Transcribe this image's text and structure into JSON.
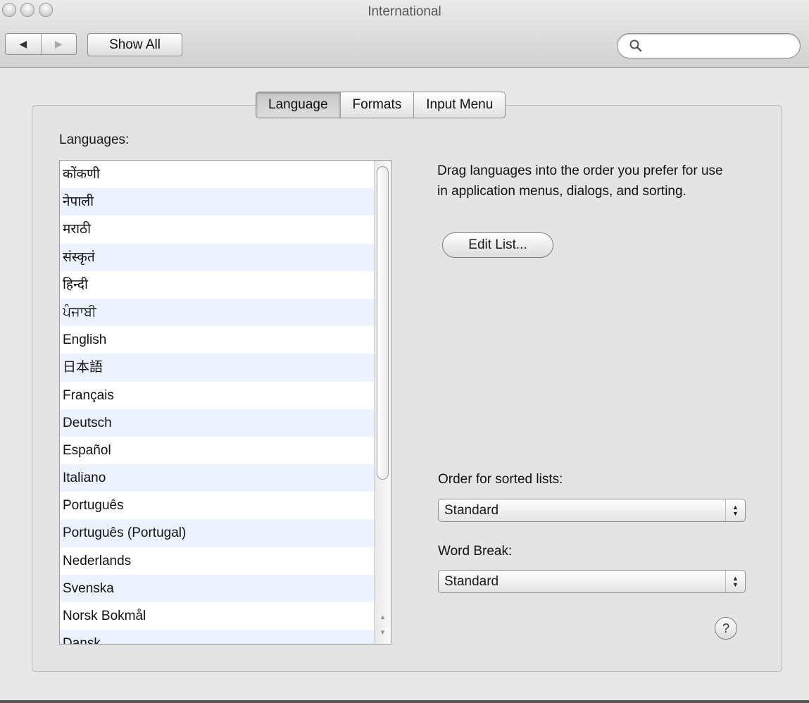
{
  "window": {
    "title": "International"
  },
  "toolbar": {
    "back_glyph": "◀",
    "forward_glyph": "▶",
    "show_all_label": "Show All",
    "search": {
      "value": "",
      "placeholder": ""
    }
  },
  "tabs": [
    {
      "label": "Language",
      "selected": true
    },
    {
      "label": "Formats",
      "selected": false
    },
    {
      "label": "Input Menu",
      "selected": false
    }
  ],
  "language_pane": {
    "languages_label": "Languages:",
    "languages": [
      "कोंकणी",
      "नेपाली",
      "मराठी",
      "संस्कृतं",
      "हिन्दी",
      "ਪੰਜਾਬੀ",
      "English",
      "日本語",
      "Français",
      "Deutsch",
      "Español",
      "Italiano",
      "Português",
      "Português (Portugal)",
      "Nederlands",
      "Svenska",
      "Norsk Bokmål",
      "Dansk"
    ],
    "description": "Drag languages into the order you prefer for use in application menus, dialogs, and sorting.",
    "edit_list_label": "Edit List...",
    "sort_order_label": "Order for sorted lists:",
    "sort_order_value": "Standard",
    "word_break_label": "Word Break:",
    "word_break_value": "Standard",
    "help_glyph": "?"
  },
  "icons": {
    "search": "search-icon",
    "popup_arrows": "up-down-arrows-icon",
    "help": "help-icon"
  }
}
